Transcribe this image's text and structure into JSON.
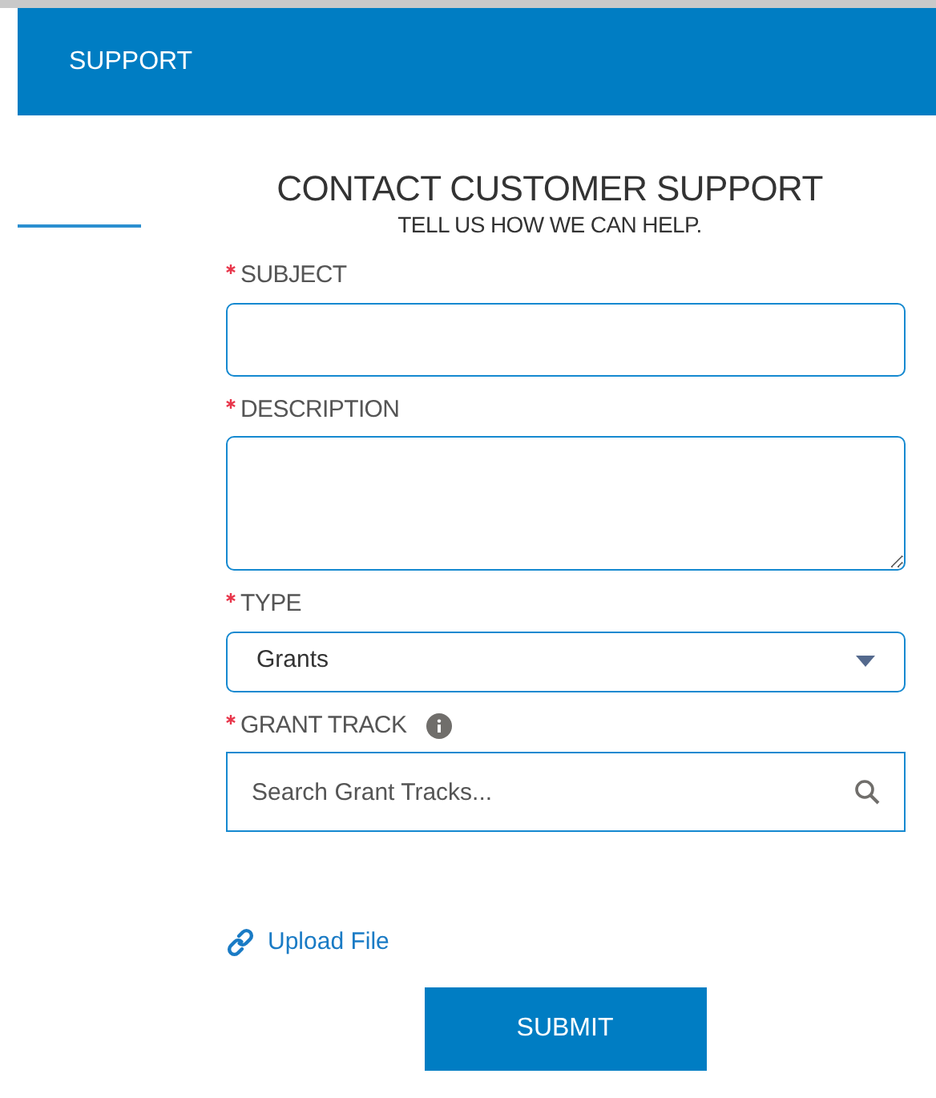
{
  "header": {
    "title": "SUPPORT"
  },
  "form": {
    "title": "CONTACT CUSTOMER SUPPORT",
    "subtitle": "TELL US HOW WE CAN HELP.",
    "fields": [
      {
        "kind": "text",
        "label": "SUBJECT",
        "required": true
      },
      {
        "kind": "textarea",
        "label": "DESCRIPTION",
        "required": true
      },
      {
        "kind": "select",
        "label": "TYPE",
        "required": true,
        "value": "Grants"
      },
      {
        "kind": "search",
        "label": "GRANT TRACK",
        "required": true,
        "info": true,
        "placeholder": "Search Grant Tracks..."
      }
    ],
    "upload_link": "Upload File",
    "submit": "SUBMIT"
  }
}
